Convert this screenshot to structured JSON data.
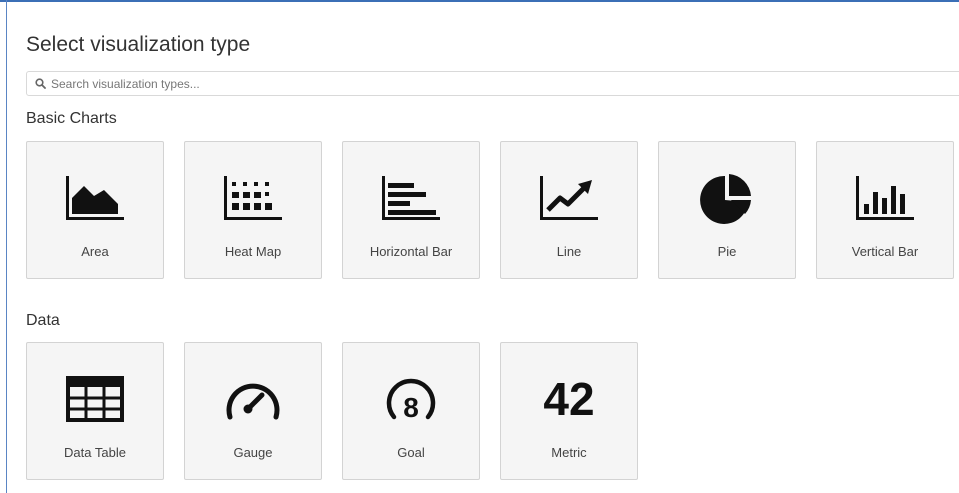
{
  "title": "Select visualization type",
  "search": {
    "placeholder": "Search visualization types..."
  },
  "sections": [
    {
      "label": "Basic Charts",
      "items": [
        {
          "label": "Area",
          "icon": "area-chart-icon"
        },
        {
          "label": "Heat Map",
          "icon": "heat-map-icon"
        },
        {
          "label": "Horizontal Bar",
          "icon": "horizontal-bar-icon"
        },
        {
          "label": "Line",
          "icon": "line-chart-icon"
        },
        {
          "label": "Pie",
          "icon": "pie-chart-icon"
        },
        {
          "label": "Vertical Bar",
          "icon": "vertical-bar-icon"
        }
      ]
    },
    {
      "label": "Data",
      "items": [
        {
          "label": "Data Table",
          "icon": "data-table-icon"
        },
        {
          "label": "Gauge",
          "icon": "gauge-icon"
        },
        {
          "label": "Goal",
          "icon": "goal-icon",
          "icon_text": "8"
        },
        {
          "label": "Metric",
          "icon": "metric-icon",
          "icon_text": "42"
        }
      ]
    }
  ]
}
